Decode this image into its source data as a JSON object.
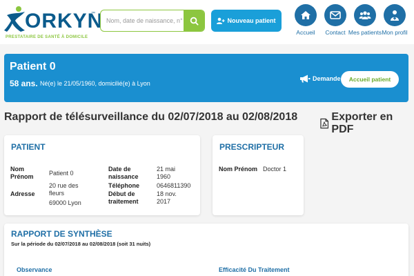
{
  "header": {
    "logo_text": "ORKYN",
    "logo_tm": "™",
    "logo_tagline": "PRESTATAIRE DE SANTÉ À DOMICILE",
    "search_placeholder": "Nom, date de naissance, n° de dossier",
    "new_patient_label": "Nouveau patient",
    "nav": [
      {
        "label": "Accueil",
        "icon": "home-icon"
      },
      {
        "label": "Contact",
        "icon": "mail-icon"
      },
      {
        "label": "Mes patients",
        "icon": "users-icon"
      },
      {
        "label": "Mon profil",
        "icon": "doctor-icon"
      }
    ]
  },
  "banner": {
    "name": "Patient 0",
    "age": "58 ans.",
    "info": "Né(e) le 21/05/1960, domicilié(e) à Lyon",
    "demande_label": "Demande",
    "accueil_label": "Accueil patient"
  },
  "report": {
    "title": "Rapport de télésurveillance du 02/07/2018 au 02/08/2018",
    "export_label": "Exporter en PDF"
  },
  "patient_card": {
    "title": "PATIENT",
    "nom_label": "Nom Prénom",
    "nom_value": "Patient 0",
    "adresse_label": "Adresse",
    "adresse_line1": "20 rue des fleurs",
    "adresse_line2": "69000 Lyon",
    "naissance_label": "Date de naissance",
    "naissance_value": "21 mai 1960",
    "telephone_label": "Téléphone",
    "telephone_value": "0646811390",
    "debut_label": "Début de traitement",
    "debut_value": "18 nov. 2017"
  },
  "prescripteur_card": {
    "title": "PRESCRIPTEUR",
    "nom_label": "Nom Prénom",
    "nom_value": "Doctor 1"
  },
  "synthese_card": {
    "title": "RAPPORT DE SYNTHÈSE",
    "subtitle": "Sur la période du 02/07/2018 au 02/08/2018 (soit 31 nuits)",
    "col1": "Observance",
    "col2": "Efficacité Du Traitement"
  },
  "colors": {
    "brand_blue": "#1f6fa6",
    "banner_blue": "#1a8fd0",
    "accent_green": "#8cc63f",
    "button_blue": "#1a9fd9"
  }
}
